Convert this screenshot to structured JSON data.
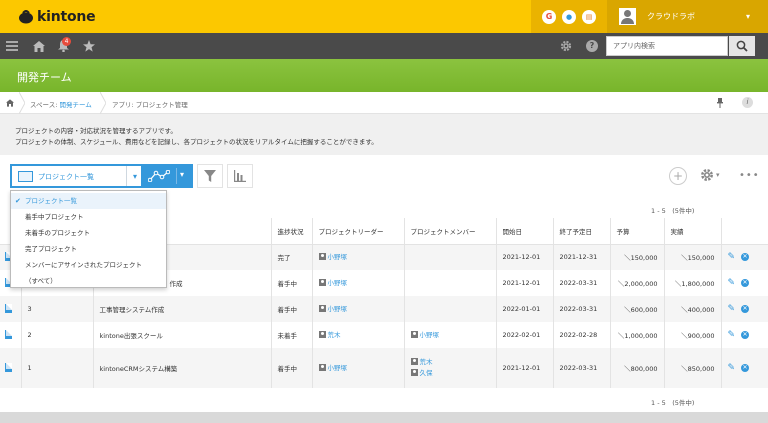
{
  "header": {
    "logo_text": "kintone",
    "user_name": "クラウドラボ",
    "services": [
      {
        "icon": "g-service-icon",
        "letter": "G",
        "color": "#e74c3c"
      },
      {
        "icon": "circle-service-icon",
        "letter": "●",
        "color": "#3498db"
      },
      {
        "icon": "mail-service-icon",
        "letter": "▤",
        "color": "#e67e22"
      }
    ]
  },
  "nav": {
    "notification_count": "4",
    "search_placeholder": "アプリ内検索"
  },
  "space": {
    "title": "開発チーム"
  },
  "breadcrumb": {
    "space_prefix": "スペース: ",
    "space_name": "開発チーム",
    "app_label": "アプリ: プロジェクト管理"
  },
  "description": {
    "line1": "プロジェクトの内容・対応状況を管理するアプリです。",
    "line2": "プロジェクトの体制、スケジュール、費用などを記録し、各プロジェクトの状況をリアルタイムに把握することができます。"
  },
  "toolbar": {
    "view_selected": "プロジェクト一覧"
  },
  "views": [
    "プロジェクト一覧",
    "着手中プロジェクト",
    "未着手のプロジェクト",
    "完了プロジェクト",
    "メンバーにアサインされたプロジェクト",
    "（すべて）"
  ],
  "pagination": {
    "label": "1 - 5　(5件中)"
  },
  "table": {
    "columns": [
      "",
      "",
      "",
      "進捗状況",
      "プロジェクトリーダー",
      "プロジェクトメンバー",
      "開始日",
      "終了予定日",
      "予算",
      "実績",
      ""
    ],
    "rows": [
      {
        "id": "",
        "name": "",
        "status": "完了",
        "leader": [
          "小野塚"
        ],
        "members": [],
        "start": "2021-12-01",
        "end": "2021-12-31",
        "budget": "＼150,000",
        "actual": "＼150,000"
      },
      {
        "id": "",
        "name": "作成",
        "status": "着手中",
        "leader": [
          "小野塚"
        ],
        "members": [],
        "start": "2021-12-01",
        "end": "2022-03-31",
        "budget": "＼2,000,000",
        "actual": "＼1,800,000"
      },
      {
        "id": "3",
        "name": "工事管理システム作成",
        "status": "着手中",
        "leader": [
          "小野塚"
        ],
        "members": [],
        "start": "2022-01-01",
        "end": "2022-03-31",
        "budget": "＼600,000",
        "actual": "＼400,000"
      },
      {
        "id": "2",
        "name": "kintone出張スクール",
        "status": "未着手",
        "leader": [
          "荒木"
        ],
        "members": [
          "小野塚"
        ],
        "start": "2022-02-01",
        "end": "2022-02-28",
        "budget": "＼1,000,000",
        "actual": "＼900,000"
      },
      {
        "id": "1",
        "name": "kintoneCRMシステム構築",
        "status": "着手中",
        "leader": [
          "小野塚"
        ],
        "members": [
          "荒木",
          "久保"
        ],
        "start": "2021-12-01",
        "end": "2022-03-31",
        "budget": "＼800,000",
        "actual": "＼850,000"
      }
    ]
  },
  "colors": {
    "brand_yellow": "#fcc800",
    "space_green": "#80bb35",
    "accent_blue": "#3498db",
    "nav_gray": "#4a4a4a"
  }
}
